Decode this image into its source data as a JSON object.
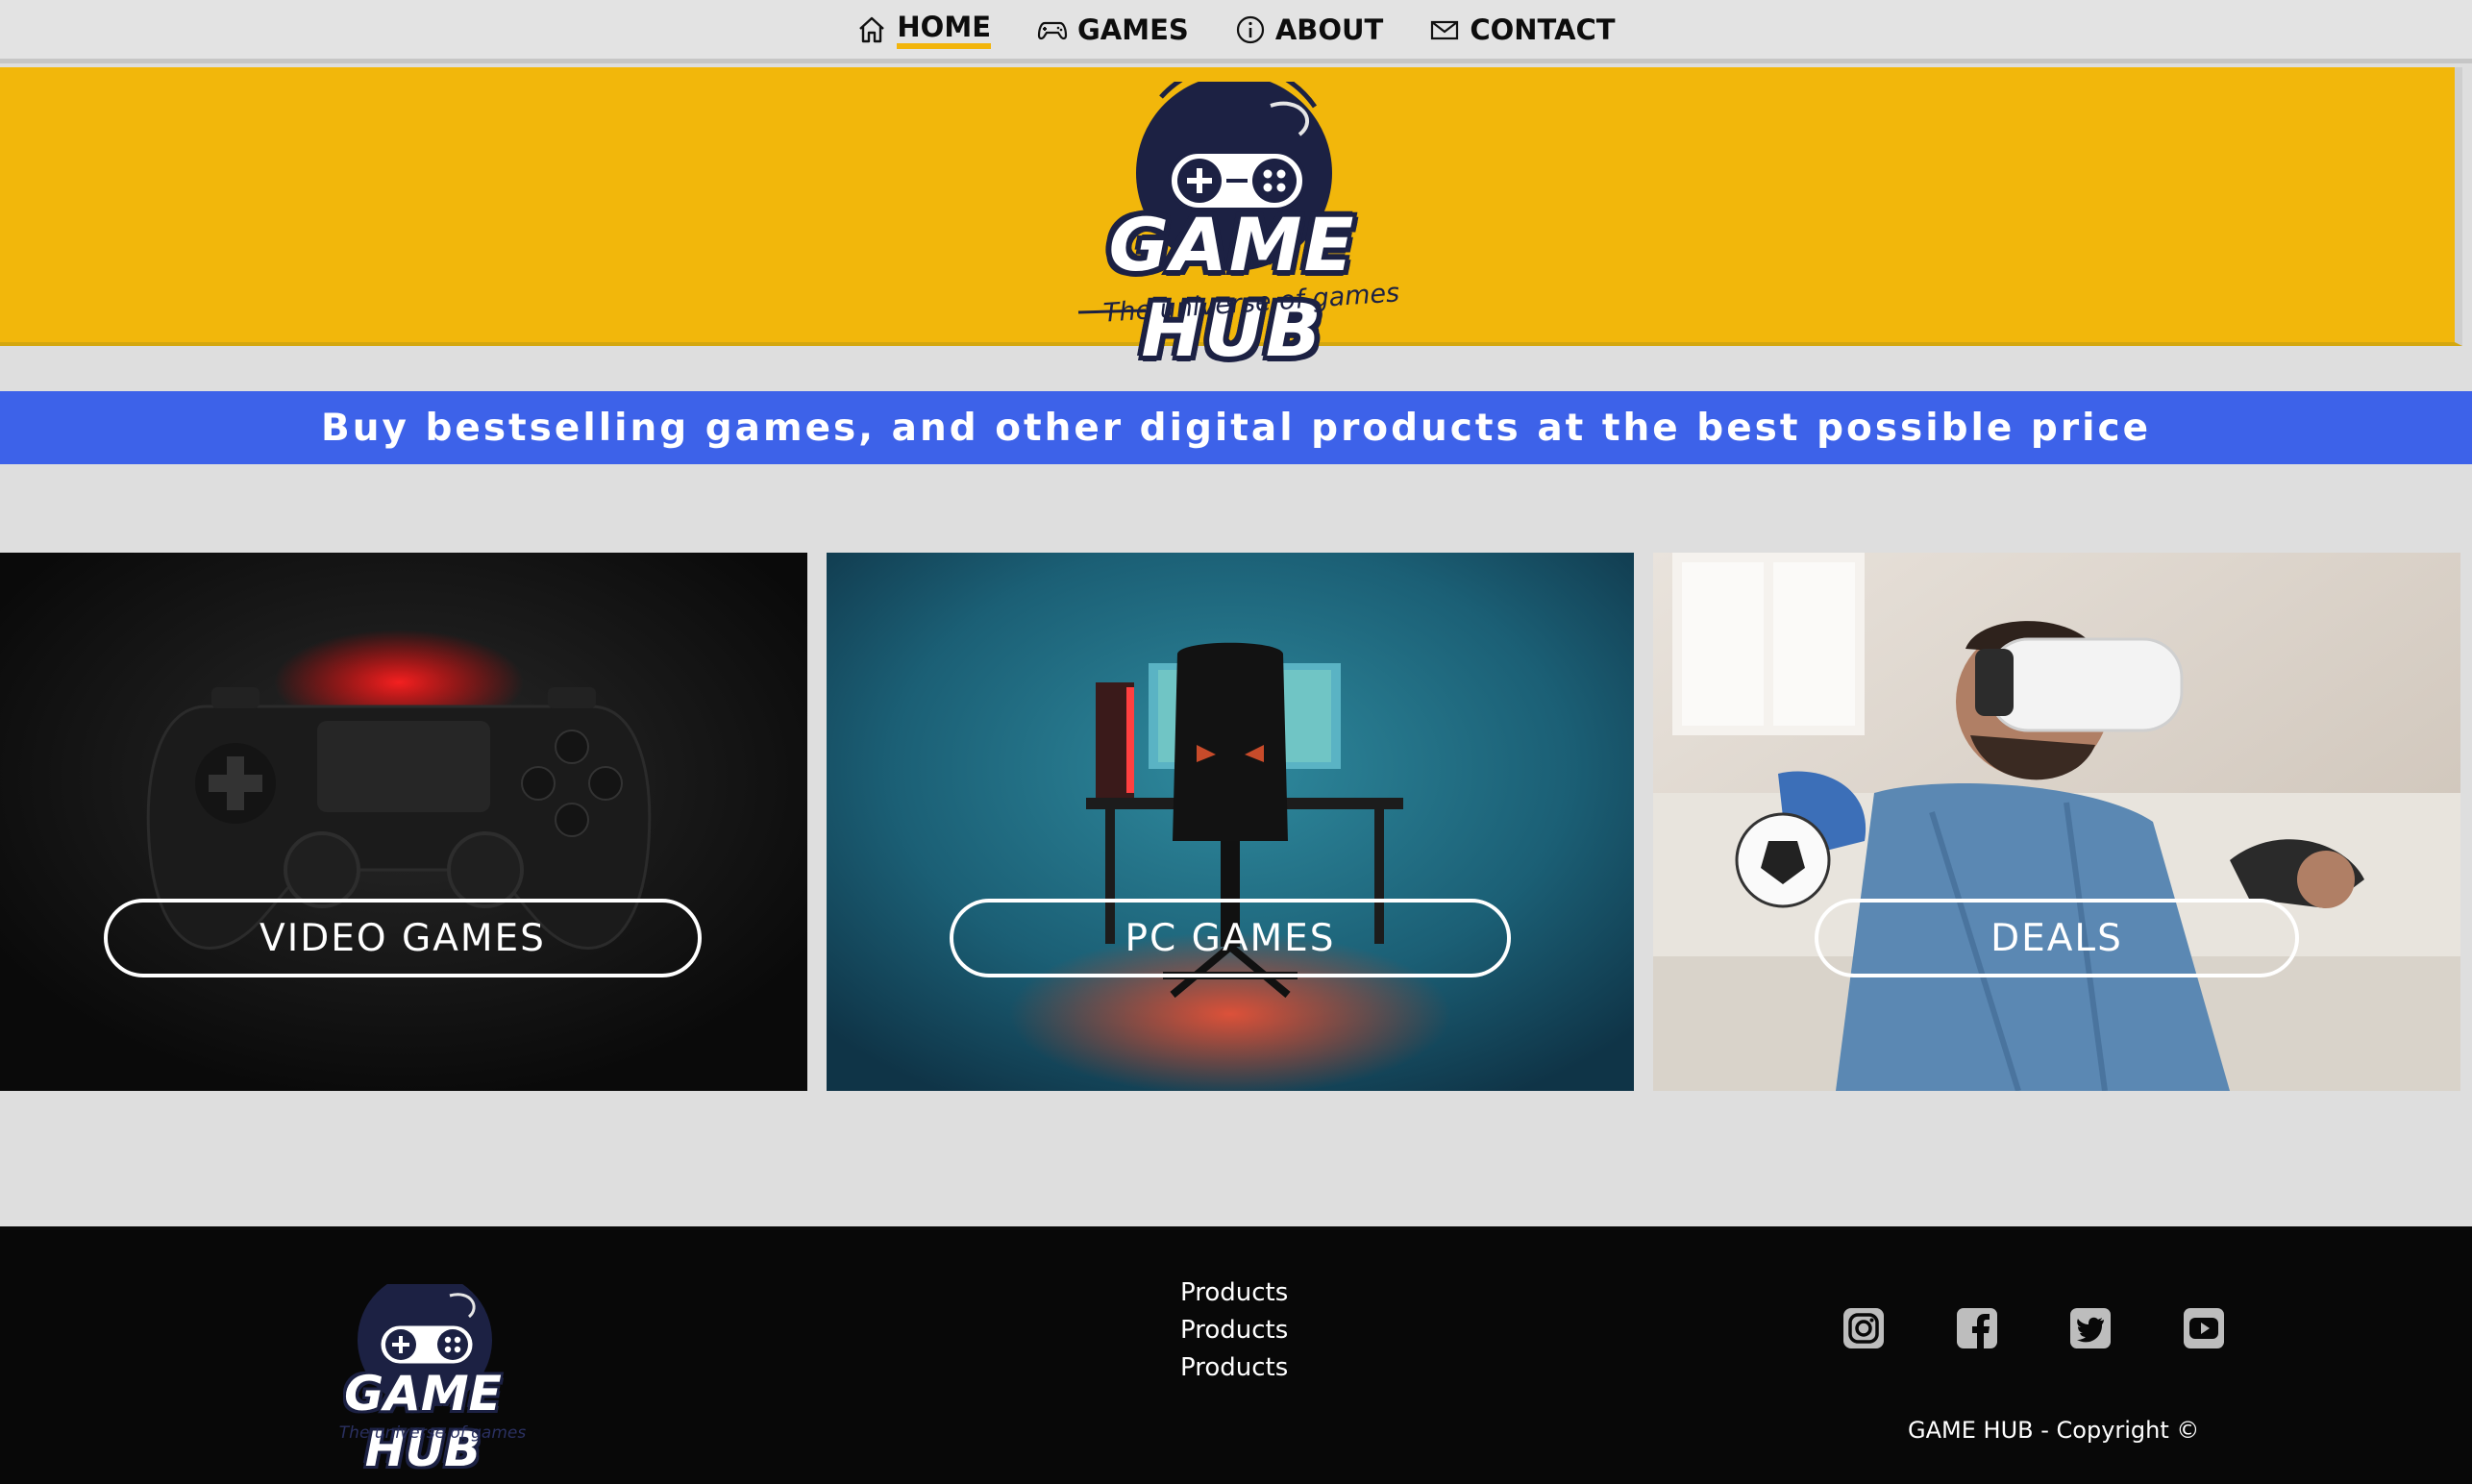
{
  "nav": {
    "items": [
      {
        "label": "HOME",
        "icon": "home-icon",
        "active": true
      },
      {
        "label": "GAMES",
        "icon": "gamepad-icon",
        "active": false
      },
      {
        "label": "ABOUT",
        "icon": "info-icon",
        "active": false
      },
      {
        "label": "CONTACT",
        "icon": "envelope-icon",
        "active": false
      }
    ]
  },
  "hero": {
    "logo_title": "GAME HUB",
    "logo_tagline": "The universe of games",
    "background_color": "#f2b70b"
  },
  "tagline": {
    "text": "Buy bestselling games, and other digital products at the best possible price",
    "background_color": "#3d62e9"
  },
  "cards": [
    {
      "label": "VIDEO GAMES",
      "image": "gamepad-photo"
    },
    {
      "label": "PC GAMES",
      "image": "gaming-desk-photo"
    },
    {
      "label": "DEALS",
      "image": "vr-player-photo"
    }
  ],
  "footer": {
    "logo_title": "GAME HUB",
    "logo_tagline": "The universe of games",
    "links": [
      "Products",
      "Products",
      "Products"
    ],
    "socials": [
      "instagram-icon",
      "facebook-icon",
      "twitter-icon",
      "youtube-icon"
    ],
    "copyright": "GAME HUB - Copyright ©"
  },
  "colors": {
    "accent_yellow": "#f2b50c",
    "accent_blue": "#3d62e9",
    "logo_navy": "#1c2143",
    "footer_bg": "#080808"
  }
}
